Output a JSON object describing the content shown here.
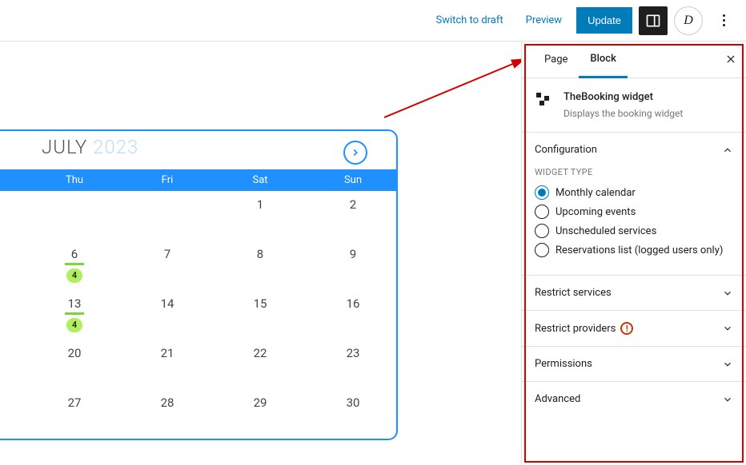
{
  "topbar": {
    "switch_draft": "Switch to draft",
    "preview": "Preview",
    "update": "Update"
  },
  "calendar": {
    "month": "JULY",
    "year": "2023",
    "day_headers": [
      "Thu",
      "Fri",
      "Sat",
      "Sun"
    ],
    "rows": [
      [
        {
          "n": ""
        },
        {
          "n": ""
        },
        {
          "n": "1"
        },
        {
          "n": "2"
        }
      ],
      [
        {
          "n": "6",
          "ul": true,
          "badge": "4"
        },
        {
          "n": "7"
        },
        {
          "n": "8"
        },
        {
          "n": "9"
        }
      ],
      [
        {
          "n": "13",
          "ul": true,
          "badge": "4"
        },
        {
          "n": "14"
        },
        {
          "n": "15"
        },
        {
          "n": "16"
        }
      ],
      [
        {
          "n": "20"
        },
        {
          "n": "21"
        },
        {
          "n": "22"
        },
        {
          "n": "23"
        }
      ],
      [
        {
          "n": "27"
        },
        {
          "n": "28"
        },
        {
          "n": "29"
        },
        {
          "n": "30"
        }
      ]
    ]
  },
  "sidebar": {
    "tabs": {
      "page": "Page",
      "block": "Block"
    },
    "block_title": "TheBooking widget",
    "block_desc": "Displays the booking widget",
    "sections": {
      "configuration": {
        "title": "Configuration",
        "widget_type_label": "WIDGET TYPE",
        "options": [
          {
            "label": "Monthly calendar",
            "checked": true
          },
          {
            "label": "Upcoming events",
            "checked": false
          },
          {
            "label": "Unscheduled services",
            "checked": false
          },
          {
            "label": "Reservations list (logged users only)",
            "checked": false
          }
        ]
      },
      "restrict_services": {
        "title": "Restrict services"
      },
      "restrict_providers": {
        "title": "Restrict providers"
      },
      "permissions": {
        "title": "Permissions"
      },
      "advanced": {
        "title": "Advanced"
      }
    }
  }
}
